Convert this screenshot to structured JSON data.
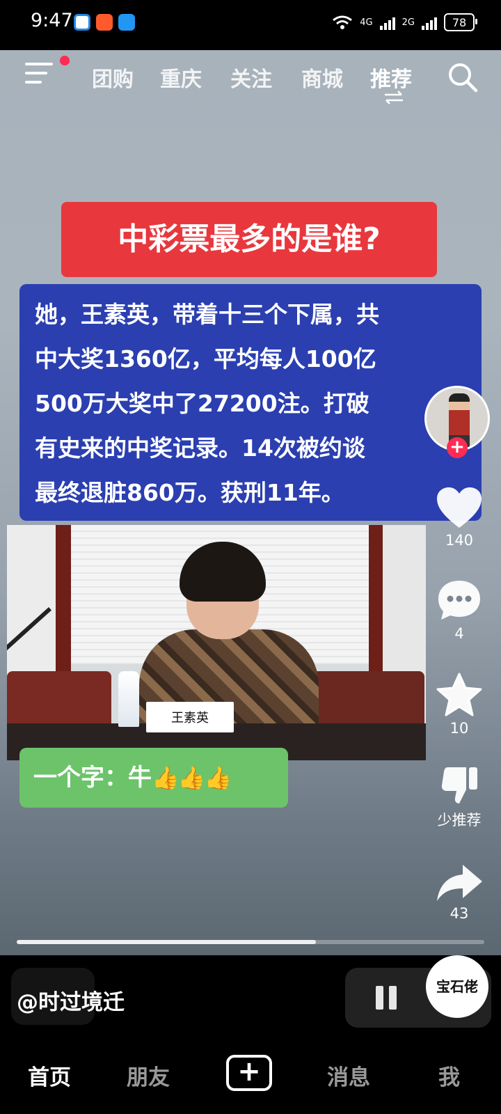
{
  "status_bar": {
    "time": "9:47",
    "network_1": "4G",
    "network_2": "2G",
    "battery": "78"
  },
  "top_nav": {
    "tabs": [
      {
        "label": "团购"
      },
      {
        "label": "重庆"
      },
      {
        "label": "关注"
      },
      {
        "label": "商城"
      },
      {
        "label": "推荐",
        "active": true
      }
    ]
  },
  "video": {
    "title": "中彩票最多的是谁?",
    "body_lines": [
      "她，王素英，带着十三个下属，共",
      "中大奖1360亿，平均每人100亿",
      "500万大奖中了27200注。打破",
      "有史来的中奖记录。14次被约谈",
      "最终退脏860万。获刑11年。"
    ],
    "nameplate": "王素英",
    "caption": "一个字：牛",
    "caption_emoji": "👍👍👍",
    "progress": 0.64
  },
  "side_rail": {
    "likes": "140",
    "comments": "4",
    "favorites": "10",
    "not_interested": "少推荐",
    "shares": "43"
  },
  "author": {
    "handle": "@时过境迁"
  },
  "music_disc_text": "宝石佬",
  "bottom_tabs": {
    "home": "首页",
    "friends": "朋友",
    "add": "+",
    "messages": "消息",
    "me": "我"
  },
  "colors": {
    "title_bg": "#e8373d",
    "text_box_bg": "#2b3fb0",
    "caption_bg": "#6cc36a",
    "accent": "#fe2c55"
  }
}
